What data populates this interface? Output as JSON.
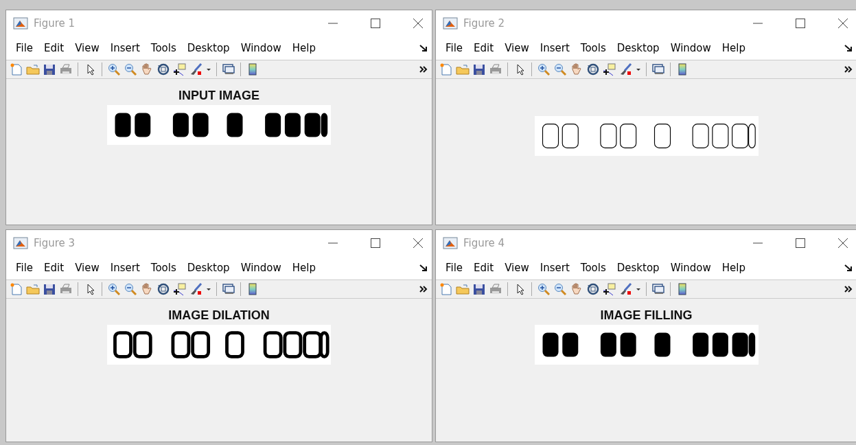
{
  "windows": [
    {
      "title": "Figure 1",
      "menu": [
        "File",
        "Edit",
        "View",
        "Insert",
        "Tools",
        "Desktop",
        "Window",
        "Help"
      ],
      "axes_title": "INPUT IMAGE"
    },
    {
      "title": "Figure 2",
      "menu": [
        "File",
        "Edit",
        "View",
        "Insert",
        "Tools",
        "Desktop",
        "Window",
        "Help"
      ]
    },
    {
      "title": "Figure 3",
      "menu": [
        "File",
        "Edit",
        "View",
        "Insert",
        "Tools",
        "Desktop",
        "Window",
        "Help"
      ],
      "axes_title": "IMAGE DILATION"
    },
    {
      "title": "Figure 4",
      "menu": [
        "File",
        "Edit",
        "View",
        "Insert",
        "Tools",
        "Desktop",
        "Window",
        "Help"
      ],
      "axes_title": "IMAGE FILLING"
    }
  ]
}
